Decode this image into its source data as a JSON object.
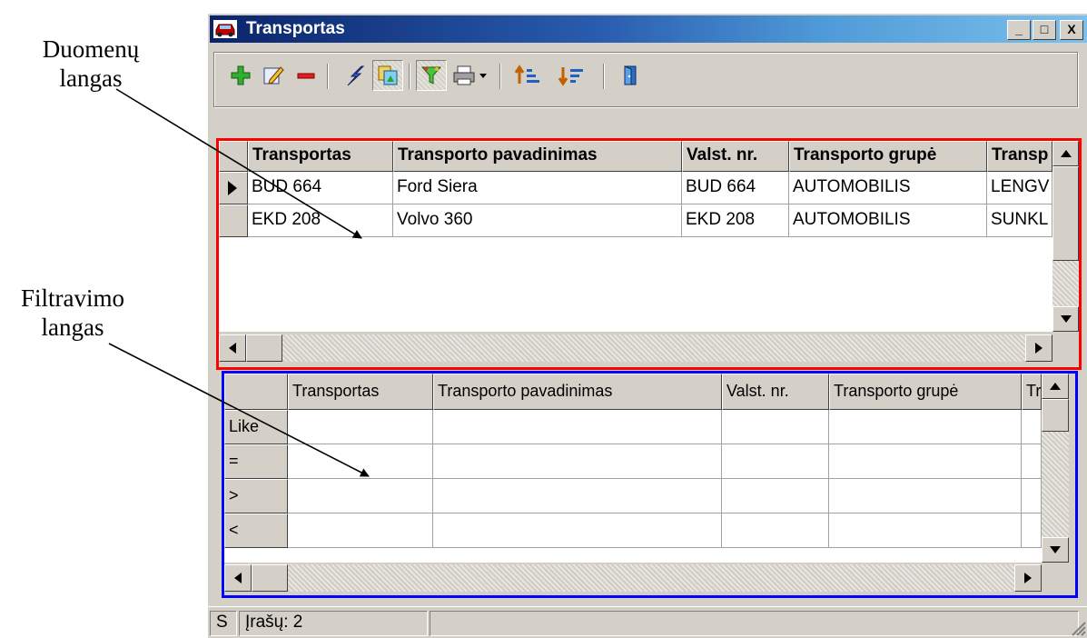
{
  "callouts": {
    "data_window_line1": "Duomenų",
    "data_window_line2": "langas",
    "filter_window_line1": "Filtravimo",
    "filter_window_line2": "langas"
  },
  "window": {
    "title": "Transportas",
    "minimize": "_",
    "maximize": "□",
    "close": "X"
  },
  "toolbar": {
    "icons": [
      "add-icon",
      "edit-icon",
      "delete-icon",
      "lightning-icon",
      "copy-icon",
      "filter-icon",
      "print-icon",
      "sort-ascending-icon",
      "sort-descending-icon",
      "exit-door-icon"
    ]
  },
  "data_grid": {
    "columns": [
      "Transportas",
      "Transporto pavadinimas",
      "Valst. nr.",
      "Transporto grupė",
      "Transp"
    ],
    "rows": [
      [
        "BUD 664",
        "Ford Siera",
        "BUD 664",
        "AUTOMOBILIS",
        "LENGV"
      ],
      [
        "EKD 208",
        "Volvo  360",
        "EKD 208",
        "AUTOMOBILIS",
        "SUNKL"
      ]
    ]
  },
  "filter_grid": {
    "columns": [
      "Transportas",
      "Transporto pavadinimas",
      "Valst. nr.",
      "Transporto grupė",
      "Tr"
    ],
    "operators": [
      "Like",
      "=",
      ">",
      "<"
    ]
  },
  "status": {
    "mode": "S",
    "records": "Įrašų: 2"
  },
  "colors": {
    "data_border": "#ff0000",
    "filter_border": "#0000ff",
    "title_start": "#0a246a",
    "title_end": "#7cc0ec"
  }
}
